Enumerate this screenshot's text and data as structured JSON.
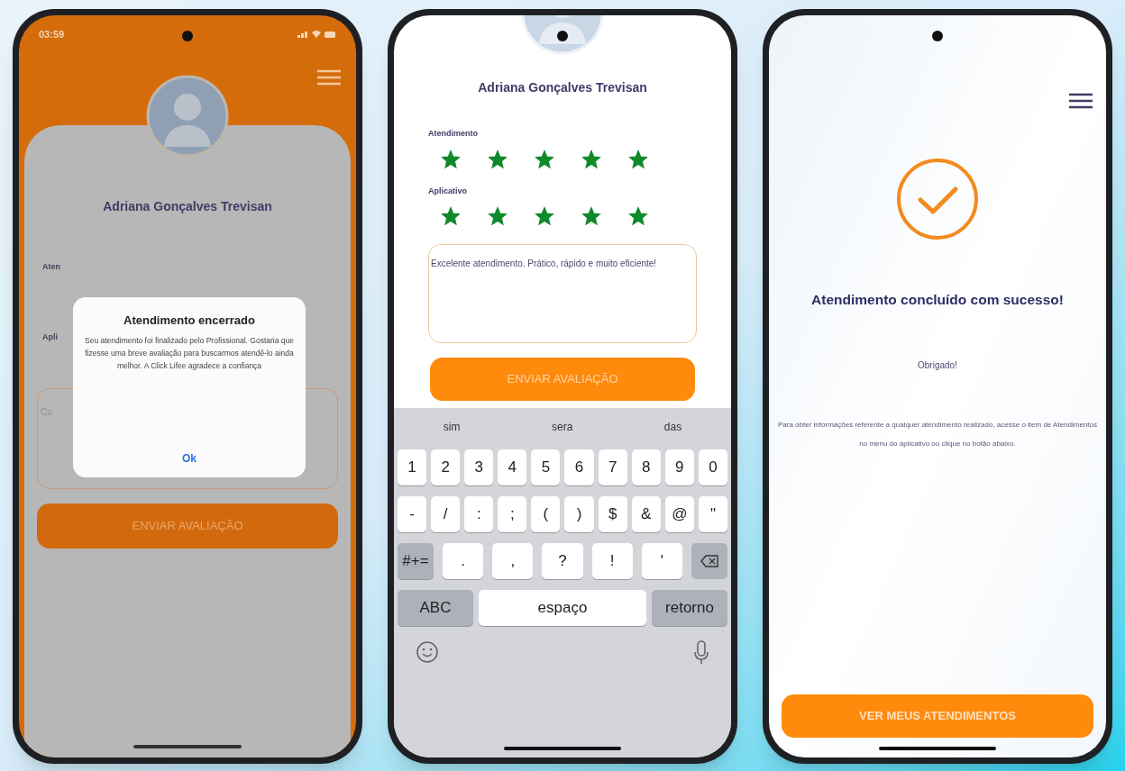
{
  "phones": [
    {
      "kind": "alert",
      "status_bar": {
        "time": "03:59"
      },
      "profile_name": "Adriana Gonçalves Trevisan",
      "labels": [
        "Aten",
        "Apli"
      ],
      "comment_placeholder": "Co",
      "submit_button": "ENVIAR AVALIAÇÃO",
      "dialog": {
        "title": "Atendimento encerrado",
        "message": "Seu atendimento foi finalizado pelo Profissional. Gostaria que fizesse uma breve avaliação para buscarmos atendê-lo ainda melhor. A Click Lifee agradece a confiança",
        "button": "Ok"
      }
    },
    {
      "kind": "rating",
      "profile_name": "Adriana Gonçalves Trevisan",
      "ratings": [
        {
          "label": "Atendimento",
          "stars": 5
        },
        {
          "label": "Aplicativo",
          "stars": 5
        }
      ],
      "comment": "Excelente atendimento. Prático, rápido e muito eficiente!",
      "submit_button": "ENVIAR AVALIAÇÃO",
      "keyboard": {
        "suggestions": [
          "sim",
          "sera",
          "das"
        ],
        "number_row": [
          "1",
          "2",
          "3",
          "4",
          "5",
          "6",
          "7",
          "8",
          "9",
          "0"
        ],
        "symbol_row": [
          "-",
          "/",
          ":",
          ";",
          "(",
          ")",
          "$",
          "&",
          "@",
          "\""
        ],
        "shift_key": "#+=",
        "punctuation_row": [
          ".",
          ",",
          "?",
          "!",
          "'"
        ],
        "bottom_row": [
          "ABC",
          "espaço",
          "retorno"
        ]
      }
    },
    {
      "kind": "success",
      "title": "Atendimento concluído com sucesso!",
      "subtitle": "Obrigado!",
      "message": "Para obter informações referente a qualquer atendimento realizado, acesse o item de Atendimentos no menu do aplicativo ou clique no botão abaixo.",
      "button": "VER MEUS ATENDIMENTOS"
    }
  ]
}
